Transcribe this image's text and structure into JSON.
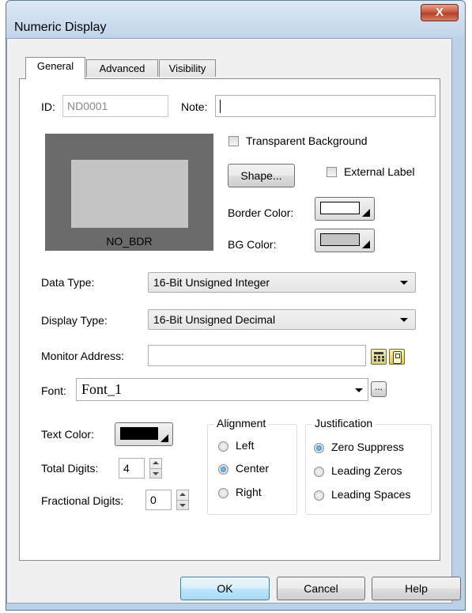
{
  "window": {
    "title": "Numeric Display",
    "close_label": "X"
  },
  "tabs": [
    {
      "label": "General"
    },
    {
      "label": "Advanced"
    },
    {
      "label": "Visibility"
    }
  ],
  "general": {
    "id_label": "ID:",
    "id_value": "ND0001",
    "note_label": "Note:",
    "note_value": "",
    "preview_caption": "NO_BDR",
    "transparent_bg_label": "Transparent Background",
    "transparent_bg_checked": false,
    "shape_button": "Shape...",
    "external_label_label": "External Label",
    "external_label_checked": false,
    "border_color_label": "Border Color:",
    "border_color": "#ffffff",
    "bg_color_label": "BG Color:",
    "bg_color": "#c4c4c4",
    "data_type_label": "Data Type:",
    "data_type_value": "16-Bit Unsigned Integer",
    "display_type_label": "Display Type:",
    "display_type_value": "16-Bit Unsigned Decimal",
    "monitor_address_label": "Monitor Address:",
    "monitor_address_value": "",
    "font_label": "Font:",
    "font_value": "Font_1",
    "font_browse": "...",
    "text_color_label": "Text Color:",
    "text_color": "#000000",
    "total_digits_label": "Total Digits:",
    "total_digits_value": "4",
    "fractional_digits_label": "Fractional Digits:",
    "fractional_digits_value": "0",
    "alignment": {
      "label": "Alignment",
      "options": [
        "Left",
        "Center",
        "Right"
      ],
      "selected": "Center"
    },
    "justification": {
      "label": "Justification",
      "options": [
        "Zero Suppress",
        "Leading Zeros",
        "Leading Spaces"
      ],
      "selected": "Zero Suppress"
    }
  },
  "footer": {
    "ok": "OK",
    "cancel": "Cancel",
    "help": "Help"
  },
  "icons": {
    "monitor_address_icon_1": "calculator-icon",
    "monitor_address_icon_2": "tag-browser-icon"
  }
}
